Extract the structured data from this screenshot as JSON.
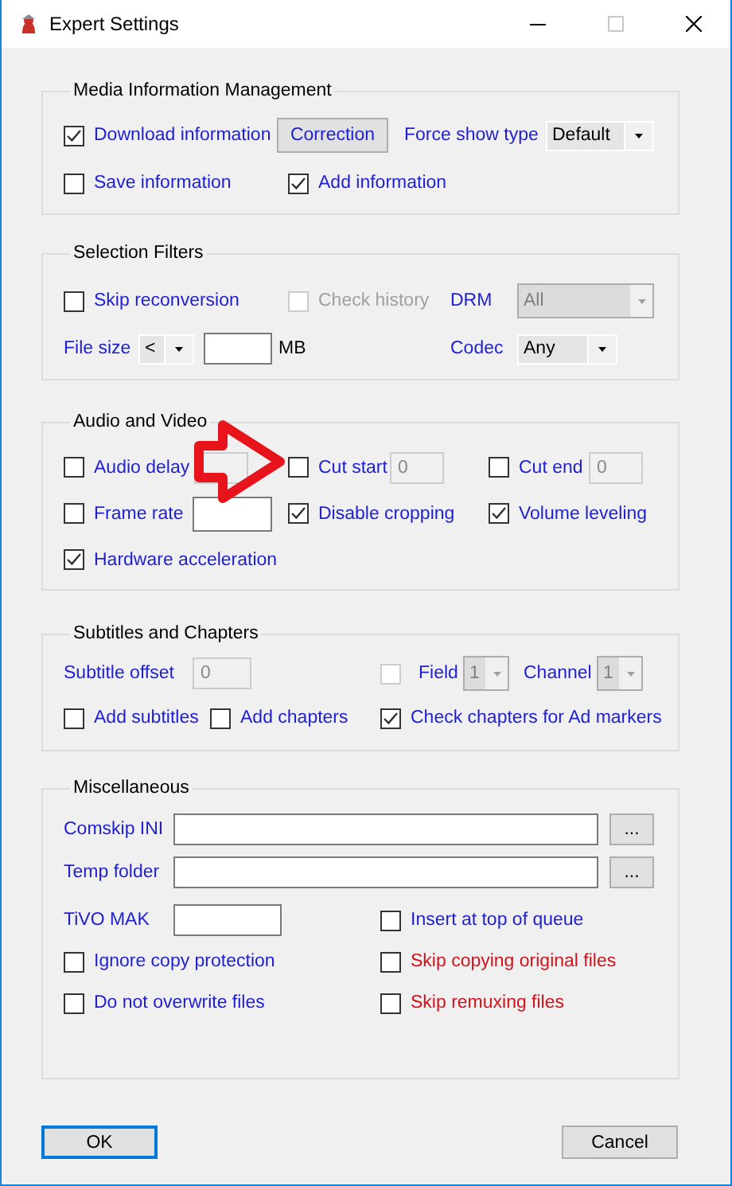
{
  "window": {
    "title": "Expert Settings",
    "maximize_disabled": true
  },
  "groups": [
    {
      "title": "Media Information Management",
      "rows": [
        [
          {
            "kind": "checkbox",
            "label": "Download information",
            "checked": true,
            "disabled": false,
            "warning": false
          },
          {
            "kind": "button",
            "label": "Correction"
          },
          {
            "kind": "label",
            "text": "Force show type"
          },
          {
            "kind": "dropdown",
            "value": "Default",
            "disabled": false
          }
        ],
        [
          {
            "kind": "checkbox",
            "label": "Save information",
            "checked": false,
            "disabled": false,
            "warning": false
          },
          {
            "kind": "checkbox",
            "label": "Add information",
            "checked": true,
            "disabled": false,
            "warning": false
          }
        ]
      ]
    },
    {
      "title": "Selection Filters",
      "rows": [
        [
          {
            "kind": "checkbox",
            "label": "Skip reconversion",
            "checked": false,
            "disabled": false,
            "warning": false
          },
          "",
          "",
          {
            "kind": "checkbox",
            "label": "Check history",
            "checked": false,
            "disabled": true,
            "warning": false
          },
          {
            "kind": "label",
            "text": "DRM"
          },
          {
            "kind": "dropdown",
            "value": "All",
            "disabled": true
          }
        ],
        [
          {
            "kind": "label",
            "text": "File size"
          },
          {
            "kind": "dropdown",
            "value": "<",
            "disabled": false
          },
          {
            "kind": "input",
            "disabled": false
          },
          {
            "kind": "unit",
            "text": "MB"
          },
          {
            "kind": "label",
            "text": "Codec"
          },
          {
            "kind": "dropdown",
            "value": "Any",
            "disabled": false
          }
        ]
      ]
    },
    {
      "title": "Audio and Video",
      "rows": [
        [
          {
            "kind": "checkbox",
            "label": "Audio delay",
            "checked": false,
            "disabled": false,
            "warning": false
          },
          {
            "kind": "input",
            "disabled": true
          },
          {
            "kind": "checkbox",
            "label": "Cut start",
            "checked": false,
            "disabled": false,
            "warning": false
          },
          {
            "kind": "input",
            "value": "0",
            "disabled": true
          },
          {
            "kind": "checkbox",
            "label": "Cut end",
            "checked": false,
            "disabled": false,
            "warning": false
          },
          {
            "kind": "input",
            "value": "0",
            "disabled": true
          }
        ],
        [
          {
            "kind": "checkbox",
            "label": "Frame rate",
            "checked": false,
            "disabled": false,
            "warning": false
          },
          {
            "kind": "input",
            "disabled": false
          },
          {
            "kind": "checkbox",
            "label": "Disable cropping",
            "checked": true,
            "disabled": false,
            "warning": false
          },
          "",
          {
            "kind": "checkbox",
            "label": "Volume leveling",
            "checked": true,
            "disabled": false,
            "warning": false
          }
        ],
        [
          {
            "kind": "checkbox",
            "label": "Hardware acceleration",
            "checked": true,
            "disabled": false,
            "warning": false
          }
        ]
      ]
    },
    {
      "title": "Subtitles and Chapters",
      "rows": [
        [
          {
            "kind": "label",
            "text": "Subtitle offset"
          },
          {
            "kind": "input",
            "value": "0",
            "disabled": true
          },
          {
            "kind": "checkbox",
            "checked": false,
            "disabled": true
          },
          {
            "kind": "label",
            "text": "Field"
          },
          {
            "kind": "dropdown",
            "value": "1",
            "disabled": true
          },
          {
            "kind": "label",
            "text": "Channel"
          },
          {
            "kind": "dropdown",
            "value": "1",
            "disabled": true
          }
        ],
        [
          {
            "kind": "checkbox",
            "label": "Add subtitles",
            "checked": false,
            "disabled": false,
            "warning": false
          },
          {
            "kind": "checkbox",
            "label": "Add chapters",
            "checked": false,
            "disabled": false,
            "warning": false
          },
          {
            "kind": "checkbox",
            "label": "Check chapters for Ad markers",
            "checked": true,
            "disabled": false,
            "warning": false
          }
        ]
      ]
    },
    {
      "title": "Miscellaneous",
      "rows": [
        [
          {
            "kind": "label",
            "text": "Comskip INI"
          },
          {
            "kind": "input",
            "disabled": false
          },
          {
            "kind": "button",
            "label": "..."
          }
        ],
        [
          {
            "kind": "label",
            "text": "Temp folder"
          },
          {
            "kind": "input",
            "disabled": false
          },
          {
            "kind": "button",
            "label": "..."
          }
        ],
        [
          {
            "kind": "label",
            "text": "TiVO MAK"
          },
          {
            "kind": "input",
            "disabled": false
          },
          {
            "kind": "checkbox",
            "label": "Insert at top of queue",
            "checked": false,
            "disabled": false,
            "warning": false
          }
        ],
        [
          {
            "kind": "checkbox",
            "label": "Ignore copy protection",
            "checked": false,
            "disabled": false,
            "warning": false
          },
          "",
          {
            "kind": "checkbox",
            "label": "Skip copying original files",
            "checked": false,
            "disabled": false,
            "warning": true
          }
        ],
        [
          {
            "kind": "checkbox",
            "label": "Do not overwrite files",
            "checked": false,
            "disabled": false,
            "warning": false
          },
          "",
          {
            "kind": "checkbox",
            "label": "Skip remuxing files",
            "checked": false,
            "disabled": false,
            "warning": true
          }
        ]
      ]
    }
  ],
  "buttons": [
    {
      "label": "OK",
      "default": true
    },
    {
      "label": "Cancel",
      "default": false
    }
  ],
  "annotation": {
    "kind": "arrow"
  }
}
